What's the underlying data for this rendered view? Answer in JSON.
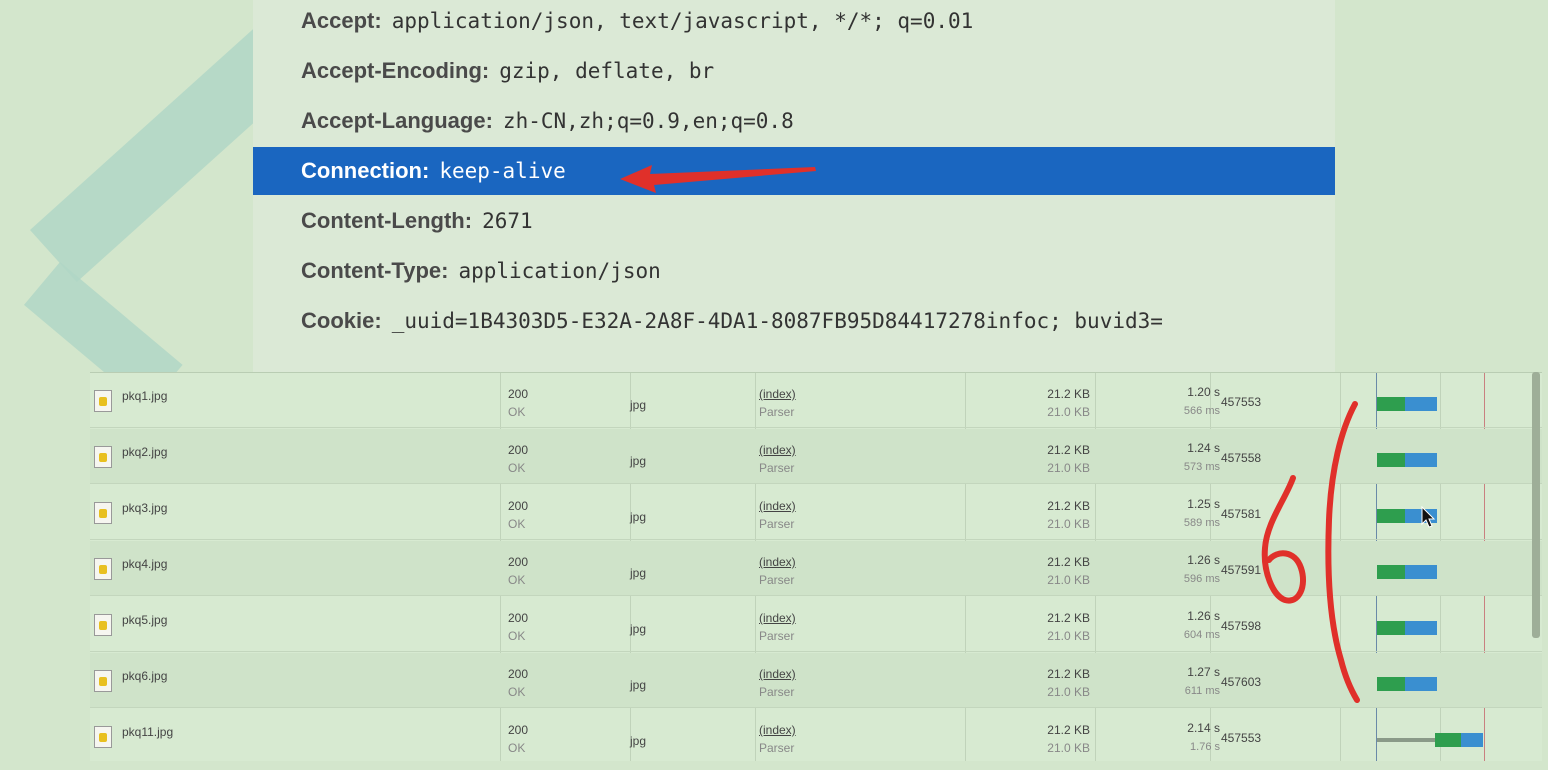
{
  "headers": [
    {
      "name": "Accept:",
      "value": "application/json, text/javascript, */*; q=0.01"
    },
    {
      "name": "Accept-Encoding:",
      "value": "gzip, deflate, br"
    },
    {
      "name": "Accept-Language:",
      "value": "zh-CN,zh;q=0.9,en;q=0.8"
    },
    {
      "name": "Connection:",
      "value": "keep-alive"
    },
    {
      "name": "Content-Length:",
      "value": "2671"
    },
    {
      "name": "Content-Type:",
      "value": "application/json"
    },
    {
      "name": "Cookie:",
      "value": "_uuid=1B4303D5-E32A-2A8F-4DA1-8087FB95D84417278infoc; buvid3="
    }
  ],
  "network": {
    "rows": [
      {
        "name": "pkq1.jpg",
        "status": "200",
        "status_text": "OK",
        "type": "jpg",
        "initiator": "(index)",
        "initiator_sub": "Parser",
        "size": "21.2 KB",
        "size_sub": "21.0 KB",
        "time": "1.20 s",
        "time_sub": "566 ms",
        "id": "457553"
      },
      {
        "name": "pkq2.jpg",
        "status": "200",
        "status_text": "OK",
        "type": "jpg",
        "initiator": "(index)",
        "initiator_sub": "Parser",
        "size": "21.2 KB",
        "size_sub": "21.0 KB",
        "time": "1.24 s",
        "time_sub": "573 ms",
        "id": "457558"
      },
      {
        "name": "pkq3.jpg",
        "status": "200",
        "status_text": "OK",
        "type": "jpg",
        "initiator": "(index)",
        "initiator_sub": "Parser",
        "size": "21.2 KB",
        "size_sub": "21.0 KB",
        "time": "1.25 s",
        "time_sub": "589 ms",
        "id": "457581"
      },
      {
        "name": "pkq4.jpg",
        "status": "200",
        "status_text": "OK",
        "type": "jpg",
        "initiator": "(index)",
        "initiator_sub": "Parser",
        "size": "21.2 KB",
        "size_sub": "21.0 KB",
        "time": "1.26 s",
        "time_sub": "596 ms",
        "id": "457591"
      },
      {
        "name": "pkq5.jpg",
        "status": "200",
        "status_text": "OK",
        "type": "jpg",
        "initiator": "(index)",
        "initiator_sub": "Parser",
        "size": "21.2 KB",
        "size_sub": "21.0 KB",
        "time": "1.26 s",
        "time_sub": "604 ms",
        "id": "457598"
      },
      {
        "name": "pkq6.jpg",
        "status": "200",
        "status_text": "OK",
        "type": "jpg",
        "initiator": "(index)",
        "initiator_sub": "Parser",
        "size": "21.2 KB",
        "size_sub": "21.0 KB",
        "time": "1.27 s",
        "time_sub": "611 ms",
        "id": "457603"
      },
      {
        "name": "pkq11.jpg",
        "status": "200",
        "status_text": "OK",
        "type": "jpg",
        "initiator": "(index)",
        "initiator_sub": "Parser",
        "size": "21.2 KB",
        "size_sub": "21.0 KB",
        "time": "2.14 s",
        "time_sub": "1.76 s",
        "id": "457553"
      }
    ]
  },
  "colors": {
    "selection": "#1a66c0",
    "bar_green": "#2e9e4e",
    "bar_blue": "#3a8fd0",
    "bar_gray": "#8a9a88",
    "annotation_red": "#e0302a"
  },
  "annotation": "6",
  "icons": {
    "file": "image-file-icon",
    "arrow": "red-arrow-annotation",
    "cursor": "mouse-cursor-icon"
  }
}
